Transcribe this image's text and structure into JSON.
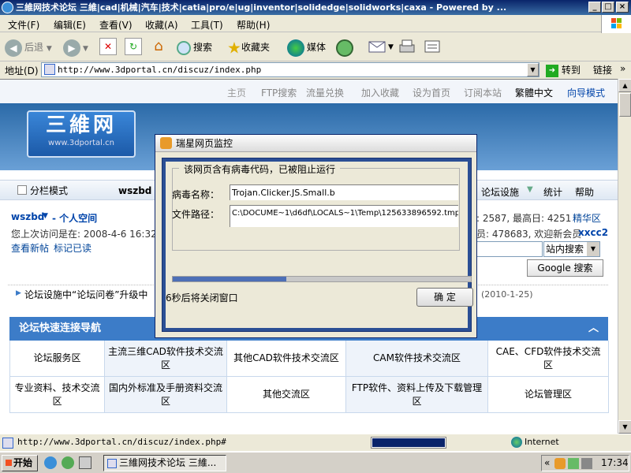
{
  "window": {
    "title": "三維网技术论坛 三維|cad|机械|汽车|技术|catia|pro/e|ug|inventor|solidedge|solidworks|caxa - Powered by ...",
    "btn_min": "_",
    "btn_max": "□",
    "btn_close": "×"
  },
  "menu": [
    "文件(F)",
    "编辑(E)",
    "查看(V)",
    "收藏(A)",
    "工具(T)",
    "帮助(H)"
  ],
  "toolbar": {
    "back": "后退",
    "search": "搜索",
    "favorites": "收藏夹",
    "media": "媒体"
  },
  "address": {
    "label": "地址(D)",
    "url": "http://www.3dportal.cn/discuz/index.php",
    "go": "转到",
    "links": "链接",
    "more": "»"
  },
  "page": {
    "topnav": [
      "主页",
      "FTP搜索",
      "流量兑换",
      "加入收藏",
      "设为首页",
      "订阅本站"
    ],
    "topnav_dark": "繁體中文",
    "topnav_blue": "向导模式",
    "logo_big": "三維网",
    "logo_small": "www.3dportal.cn",
    "split_mode": "分栏模式",
    "user_short": "wszbd",
    "forum_facilities": "论坛设施",
    "stats": "统计",
    "help": "帮助",
    "username": "wszbd",
    "personal_space": "- 个人空间",
    "last_visit": "您上次访问是在: 2008-4-6 16:32",
    "view_new": "查看新帖",
    "mark_read": "标记已读",
    "stats_line1": ": 2587, 最高日: 4251",
    "elite": "精华区",
    "stats_line2": "员: 478683, 欢迎新会员",
    "new_member": "xxcc2",
    "site_search": "站内搜索",
    "google_search": "Google 搜索",
    "announce": "论坛设施中“论坛问卷”升级中",
    "announce_date": "(2010-1-25)",
    "quicknav_title": "论坛快速连接导航",
    "quicknav_arrow": "︿",
    "quicknav": [
      "论坛服务区",
      "主流三维CAD软件技术交流区",
      "其他CAD软件技术交流区",
      "CAM软件技术交流区",
      "CAE、CFD软件技术交流区",
      "专业资料、技术交流区",
      "国内外标准及手册资料交流区",
      "其他交流区",
      "FTP软件、资料上传及下载管理区",
      "论坛管理区"
    ]
  },
  "dialog": {
    "title": "瑞星网页监控",
    "group_label": "该网页含有病毒代码，已被阻止运行",
    "virus_label": "病毒名称：",
    "virus_value": "Trojan.Clicker.JS.Small.b",
    "path_label": "文件路径：",
    "path_value": "C:\\DOCUME~1\\d6df\\LOCALS~1\\Temp\\125633896592.tmp",
    "countdown": "6秒后将关闭窗口",
    "ok": "确 定",
    "progress": 0.38
  },
  "statusbar": {
    "url": "http://www.3dportal.cn/discuz/index.php#",
    "zone": "Internet"
  },
  "taskbar": {
    "start": "开始",
    "task": "三維网技术论坛 三維...",
    "tray_arrow": "«",
    "time": "17:34"
  },
  "colors": {
    "accent": "#0a246a",
    "forum_blue": "#3c7cc8",
    "dialog_frame": "#2b4f95"
  }
}
